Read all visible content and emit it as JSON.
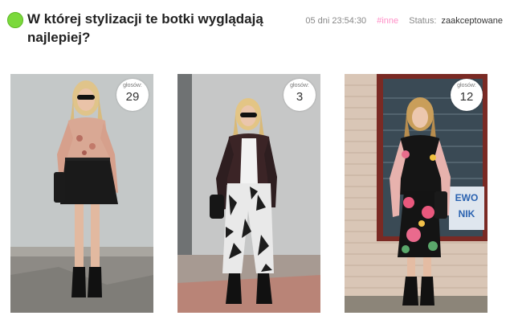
{
  "question": {
    "title": "W której stylizacji te botki wyglądają najlepiej?",
    "status_color": "#7bd93c"
  },
  "meta": {
    "time_left": "05 dni 23:54:30",
    "tag": "#inne",
    "status_label": "Status:",
    "status_value": "zaakceptowane"
  },
  "options": [
    {
      "vote_label": "głosów:",
      "votes": "29"
    },
    {
      "vote_label": "głosów:",
      "votes": "3"
    },
    {
      "vote_label": "głosów:",
      "votes": "12"
    }
  ],
  "photos": [
    {
      "name": "outfit-photo-1",
      "description_icon": "person-photo"
    },
    {
      "name": "outfit-photo-2",
      "description_icon": "person-photo"
    },
    {
      "name": "outfit-photo-3",
      "description_icon": "person-photo",
      "sign_text": "EWO NIK"
    }
  ]
}
